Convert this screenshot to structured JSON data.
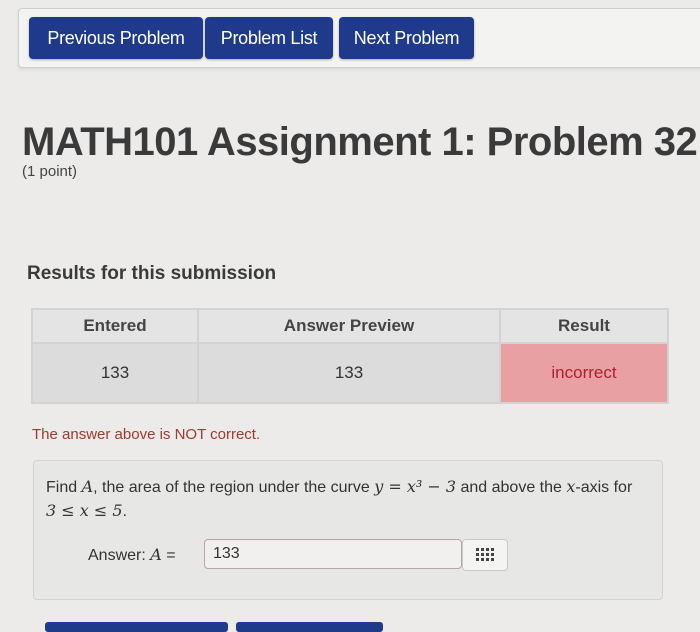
{
  "nav": {
    "previous": "Previous Problem",
    "list": "Problem List",
    "next": "Next Problem"
  },
  "header": {
    "title": "MATH101 Assignment 1: Problem 32",
    "points": "(1 point)"
  },
  "results": {
    "heading": "Results for this submission",
    "columns": [
      "Entered",
      "Answer Preview",
      "Result"
    ],
    "row": {
      "entered": "133",
      "preview": "133",
      "result": "incorrect"
    }
  },
  "feedback": "The answer above is NOT correct.",
  "problem": {
    "text_a": "Find ",
    "var_A": "A",
    "text_b": ", the area of the region under the curve ",
    "curve": "y = x³ − 3",
    "text_c": " and above the ",
    "axis": "x",
    "text_d": "-axis for ",
    "range": "3 ≤ x ≤ 5",
    "text_e": ".",
    "answer_label_a": "Answer: ",
    "answer_label_var": "A",
    "answer_label_eq": " =",
    "answer_value": "133",
    "keyboard_icon": "keyboard-grid-icon"
  },
  "colors": {
    "nav_button": "#1f3a8a",
    "incorrect_bg": "#e8a0a3",
    "incorrect_text": "#b31e2e"
  }
}
